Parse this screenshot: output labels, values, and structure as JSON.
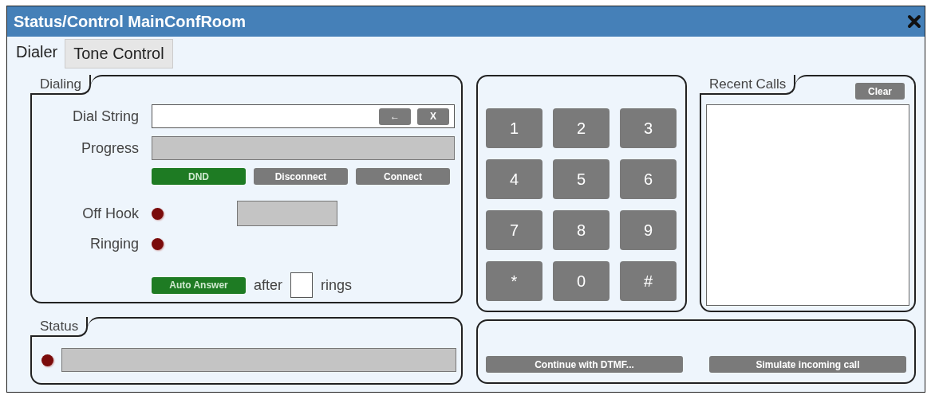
{
  "window": {
    "title": "Status/Control MainConfRoom"
  },
  "tabs": [
    {
      "label": "Dialer",
      "selected": true
    },
    {
      "label": "Tone Control",
      "selected": false
    }
  ],
  "dialing": {
    "title": "Dialing",
    "dial_string_label": "Dial String",
    "backspace": "←",
    "clear": "X",
    "progress_label": "Progress",
    "dnd": {
      "label": "DND",
      "on": true
    },
    "disconnect": "Disconnect",
    "connect": "Connect",
    "leds": [
      {
        "label": "Off Hook",
        "on": false
      },
      {
        "label": "Ringing",
        "on": false
      }
    ],
    "auto_answer": {
      "label": "Auto Answer",
      "on": true
    },
    "after": "after",
    "rings": "rings"
  },
  "status": {
    "title": "Status",
    "led_on": false
  },
  "keypad": [
    "1",
    "2",
    "3",
    "4",
    "5",
    "6",
    "7",
    "8",
    "9",
    "*",
    "0",
    "#"
  ],
  "recent_calls": {
    "title": "Recent Calls",
    "clear": "Clear"
  },
  "actions": [
    "Continue with DTMF...",
    "Simulate incoming call"
  ]
}
